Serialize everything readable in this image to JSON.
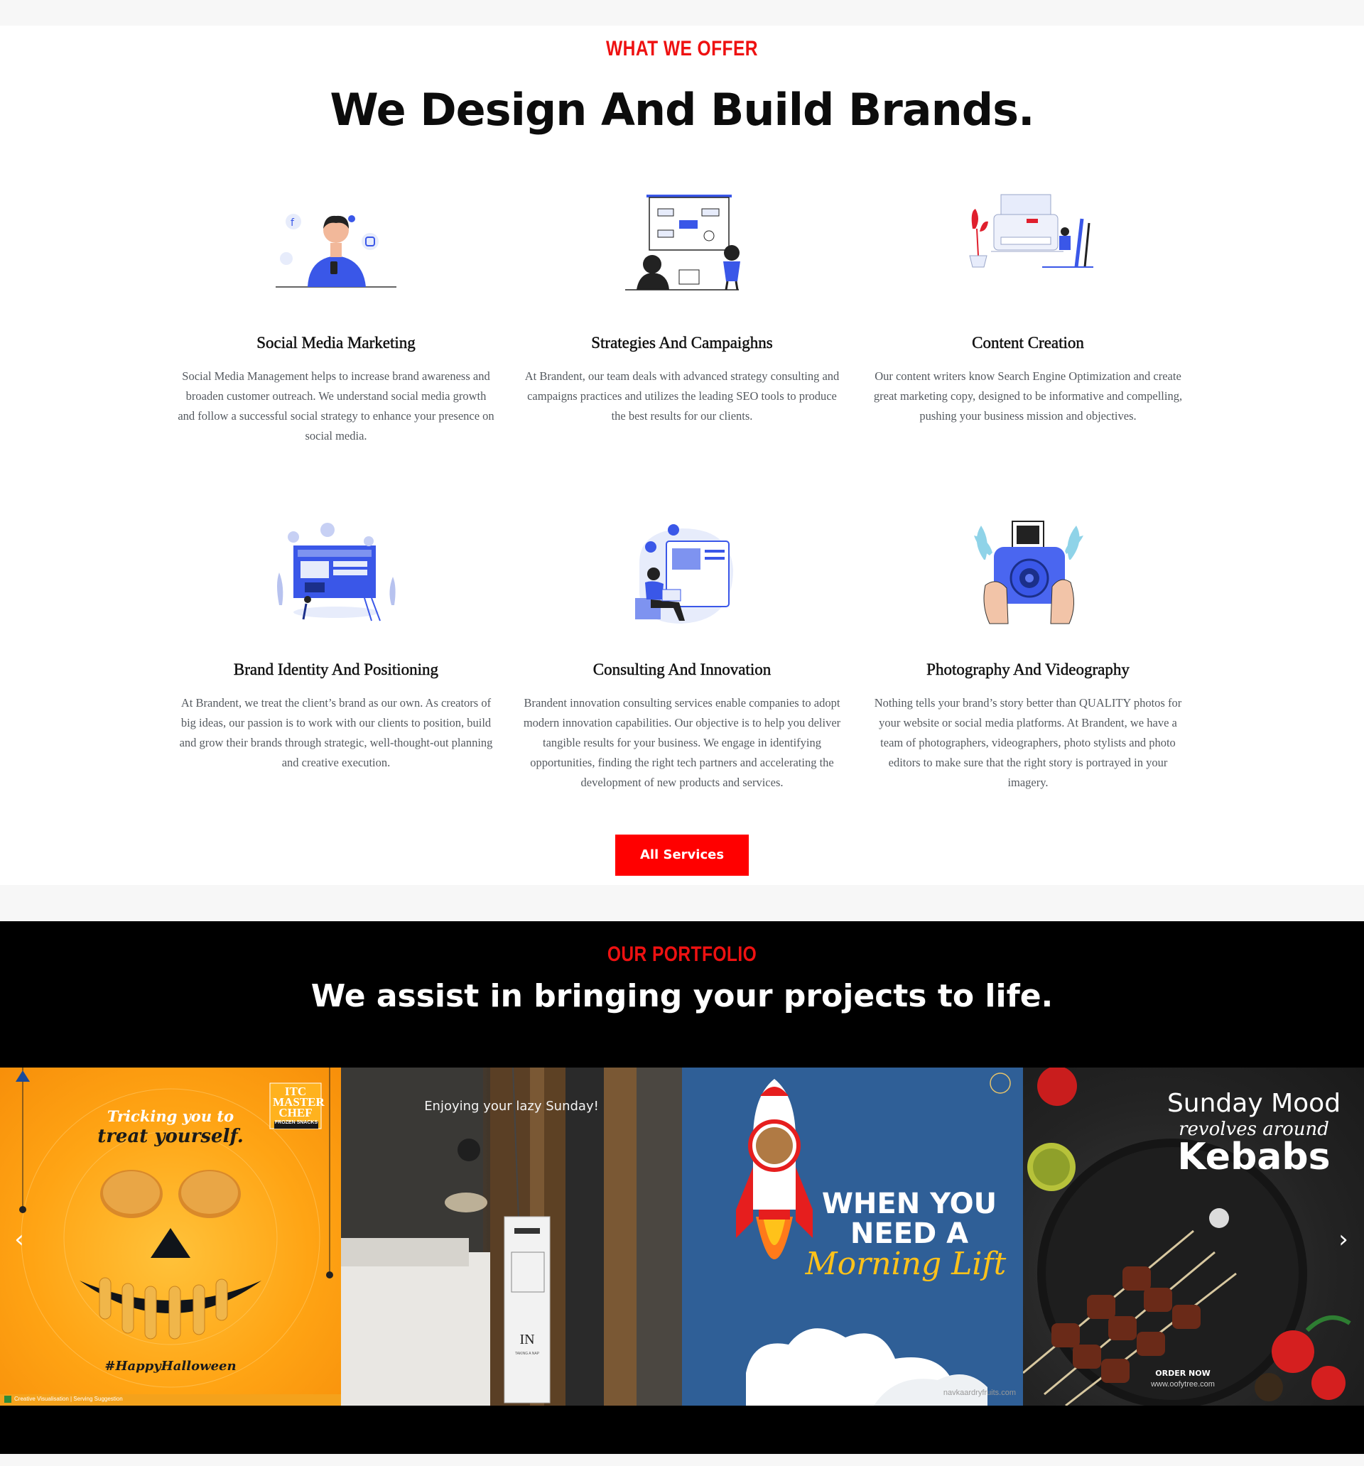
{
  "colors": {
    "accent": "#ff0000",
    "eyebrow": "#ee1111",
    "body_text": "#555a60",
    "dark_bg": "#000000"
  },
  "offer": {
    "eyebrow": "WHAT WE OFFER",
    "title": "We Design And Build Brands.",
    "services": [
      {
        "icon": "social-media-illustration",
        "title": "Social Media Marketing",
        "text": "Social Media Management helps to increase brand awareness and broaden customer outreach. We understand social media growth and follow a successful social strategy to enhance your presence on social media."
      },
      {
        "icon": "strategy-illustration",
        "title": "Strategies And Campaighns",
        "text": "At Brandent, our team deals with advanced strategy consulting and campaigns practices and utilizes the leading SEO tools to produce the best results for our clients."
      },
      {
        "icon": "content-creation-illustration",
        "title": "Content Creation",
        "text": "Our content writers know Search Engine Optimization and create great marketing copy, designed to be informative and compelling, pushing your business mission and objectives."
      },
      {
        "icon": "brand-identity-illustration",
        "title": "Brand Identity And Positioning",
        "text": "At Brandent, we treat the client’s brand as our own. As creators of big ideas, our passion is to work with our clients to position, build and grow their brands through strategic, well-thought-out planning and creative execution."
      },
      {
        "icon": "innovation-illustration",
        "title": "Consulting And Innovation",
        "text": "Brandent innovation consulting services enable companies to adopt modern innovation capabilities. Our objective is to help you deliver tangible results for your business. We engage in identifying opportunities, finding the right tech partners and accelerating the development of new products and services."
      },
      {
        "icon": "camera-illustration",
        "title": "Photography And Videography",
        "text": "Nothing tells your brand’s story better than QUALITY photos for your website or social media platforms. At Brandent, we have a team of photographers, videographers, photo stylists and photo editors to make sure that the right story is portrayed in your imagery."
      }
    ],
    "button": "All Services"
  },
  "portfolio": {
    "eyebrow": "OUR PORTFOLIO",
    "title": "We assist in bringing your projects to life.",
    "slides": {
      "s1": {
        "logo": "ITC MASTER CHEF",
        "logo_sub": "FROZEN SNACKS",
        "line1": "Tricking you to",
        "line2": "treat yourself.",
        "hashtag": "#HappyHalloween",
        "footer": "Creative Visualisation | Serving Suggestion"
      },
      "s2": {
        "caption": "Enjoying your lazy Sunday!",
        "tag_big": "IN",
        "tag_small": "TAKING A NAP"
      },
      "s3": {
        "line1": "WHEN YOU",
        "line2": "NEED A",
        "script": "Morning Lift",
        "url": "navkaardryfruits.com"
      },
      "s4": {
        "line1": "Sunday Mood",
        "script": "revolves around",
        "line3": "Kebabs",
        "cta": "ORDER NOW",
        "url": "www.oofytree.com"
      }
    },
    "prev_icon": "chevron-left-icon",
    "next_icon": "chevron-right-icon"
  }
}
